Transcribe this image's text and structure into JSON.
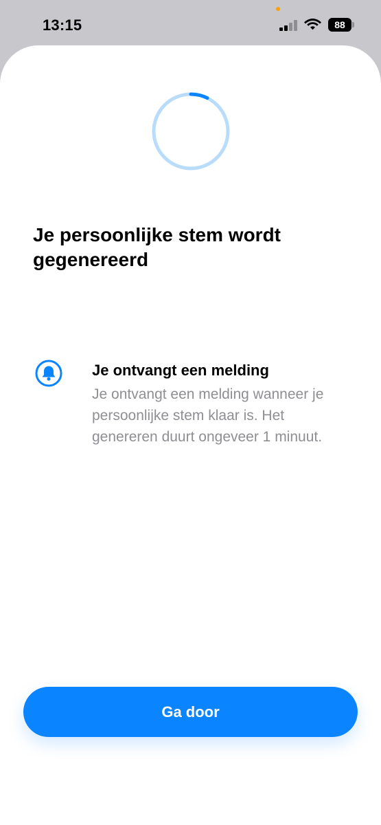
{
  "status_bar": {
    "time": "13:15",
    "battery_level": "88",
    "icons": [
      "signal-icon",
      "wifi-icon",
      "battery-icon"
    ]
  },
  "colors": {
    "accent": "#0a84ff",
    "spinner_track": "#b9dcfb",
    "secondary_text": "#8e8e93",
    "status_bar_bg": "#c7c7cc"
  },
  "progress": {
    "icon": "progress-spinner"
  },
  "main": {
    "title": "Je persoonlijke stem wordt gegenereerd"
  },
  "notice": {
    "icon": "bell-icon",
    "title": "Je ontvangt een melding",
    "body": "Je ontvangt een melding wanneer je persoonlijke stem klaar is. Het genereren duurt ongeveer 1 minuut."
  },
  "actions": {
    "continue_label": "Ga door"
  }
}
